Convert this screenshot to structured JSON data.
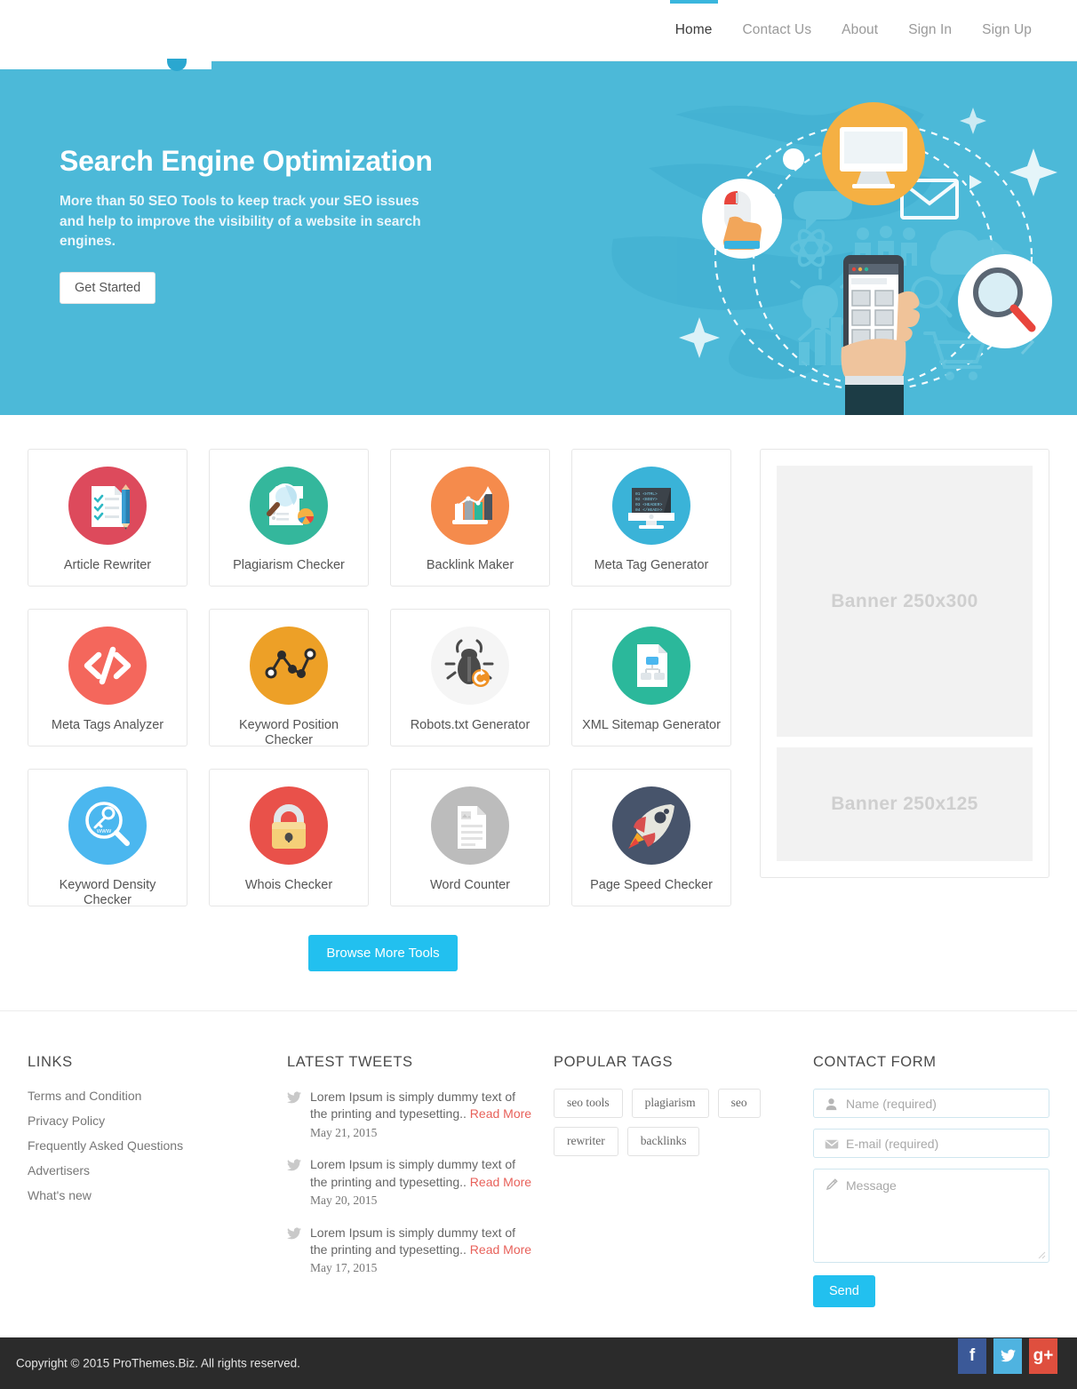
{
  "nav": {
    "items": [
      {
        "label": "Home",
        "active": true
      },
      {
        "label": "Contact Us",
        "active": false
      },
      {
        "label": "About",
        "active": false
      },
      {
        "label": "Sign In",
        "active": false
      },
      {
        "label": "Sign Up",
        "active": false
      }
    ]
  },
  "hero": {
    "title": "Search Engine Optimization",
    "subtitle": "More than 50 SEO Tools to keep track your SEO issues and help to improve the visibility of a website in search engines.",
    "cta_label": "Get Started",
    "background_color": "#4cb9d8",
    "illustration_name": "seo-network-illustration"
  },
  "tools": {
    "items": [
      {
        "label": "Article Rewriter",
        "icon": "document-checklist-pencil-icon",
        "color": "#dd4a5c"
      },
      {
        "label": "Plagiarism Checker",
        "icon": "magnifier-report-icon",
        "color": "#34b79c"
      },
      {
        "label": "Backlink Maker",
        "icon": "bar-chart-growth-icon",
        "color": "#f58b4c"
      },
      {
        "label": "Meta Tag Generator",
        "icon": "monitor-code-icon",
        "color": "#3ab3d8"
      },
      {
        "label": "Meta Tags Analyzer",
        "icon": "code-brackets-icon",
        "color": "#f4675c"
      },
      {
        "label": "Keyword Position Checker",
        "icon": "line-chart-nodes-icon",
        "color": "#eda027"
      },
      {
        "label": "Robots.txt Generator",
        "icon": "bug-icon",
        "color": "#f5f5f5"
      },
      {
        "label": "XML Sitemap Generator",
        "icon": "sitemap-document-icon",
        "color": "#2bb89b"
      },
      {
        "label": "Keyword Density Checker",
        "icon": "magnifier-key-www-icon",
        "color": "#4bb7ef"
      },
      {
        "label": "Whois Checker",
        "icon": "padlock-icon",
        "color": "#e9514a"
      },
      {
        "label": "Word Counter",
        "icon": "text-document-icon",
        "color": "#bcbcbc"
      },
      {
        "label": "Page Speed Checker",
        "icon": "rocket-icon",
        "color": "#47546b"
      }
    ],
    "browse_label": "Browse More Tools"
  },
  "sidebar": {
    "banners": [
      {
        "label": "Banner  250x300"
      },
      {
        "label": "Banner  250x125"
      }
    ]
  },
  "footer": {
    "links": {
      "title": "LINKS",
      "items": [
        "Terms and Condition",
        "Privacy Policy",
        "Frequently Asked Questions",
        "Advertisers",
        "What's new"
      ]
    },
    "tweets": {
      "title": "LATEST TWEETS",
      "items": [
        {
          "text": "Lorem Ipsum is simply dummy text of the printing and typesetting..",
          "more": "Read More",
          "date": "May 21, 2015"
        },
        {
          "text": "Lorem Ipsum is simply dummy text of the printing and typesetting..",
          "more": "Read More",
          "date": "May 20, 2015"
        },
        {
          "text": "Lorem Ipsum is simply dummy text of the printing and typesetting..",
          "more": "Read More",
          "date": "May 17, 2015"
        }
      ]
    },
    "tags": {
      "title": "POPULAR TAGS",
      "items": [
        "seo tools",
        "plagiarism",
        "seo",
        "rewriter",
        "backlinks"
      ]
    },
    "contact": {
      "title": "CONTACT FORM",
      "name_placeholder": "Name (required)",
      "name_value": "",
      "email_placeholder": "E-mail (required)",
      "email_value": "",
      "message_placeholder": "Message",
      "message_value": "",
      "send_label": "Send"
    }
  },
  "bottom": {
    "copyright": "Copyright © 2015 ProThemes.Biz. All rights reserved.",
    "socials": [
      {
        "name": "facebook",
        "glyph": "f",
        "color": "#3b5998"
      },
      {
        "name": "twitter",
        "glyph": "",
        "color": "#4fb3e0"
      },
      {
        "name": "google-plus",
        "glyph": "g+",
        "color": "#df4f3e"
      }
    ]
  }
}
